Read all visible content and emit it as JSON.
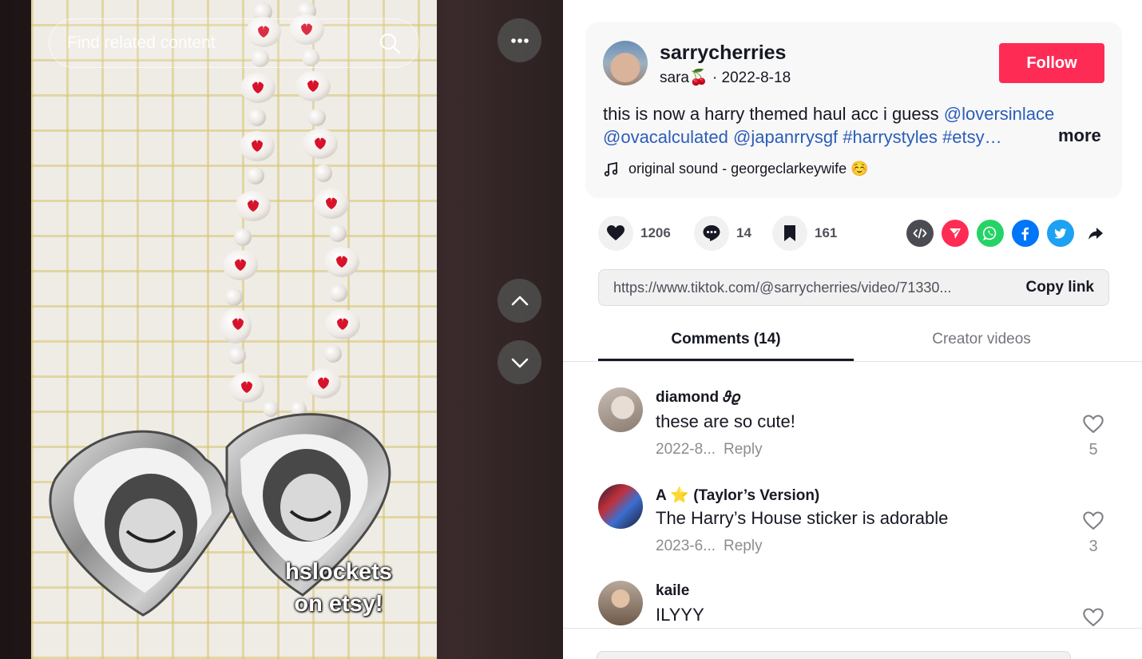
{
  "search": {
    "placeholder": "Find related content",
    "icon": "search-icon"
  },
  "video": {
    "overlay_line1": "hslockets",
    "overlay_line2": "on etsy!",
    "more_icon": "more-horizontal-icon",
    "prev_icon": "chevron-up-icon",
    "next_icon": "chevron-down-icon"
  },
  "author": {
    "username": "sarrycherries",
    "nickname": "sara🍒",
    "separator": " · ",
    "date": "2022-8-18",
    "follow_label": "Follow"
  },
  "caption": {
    "text": "this is now a harry themed haul acc i guess ",
    "tag1": "@loversinlace",
    "tag2": "@ovacalculated",
    "tag3": "@japanrrysgf",
    "tag4": "#harrystyles",
    "tag5": "#etsy…",
    "more_label": "more"
  },
  "sound": {
    "label": "original sound - georgeclarkeywife ☺️",
    "icon": "music-note-icon"
  },
  "stats": {
    "likes": "1206",
    "comments": "14",
    "saves": "161"
  },
  "share_icons": [
    "embed-icon",
    "send-icon",
    "whatsapp-icon",
    "facebook-icon",
    "twitter-icon",
    "share-arrow-icon"
  ],
  "colors": {
    "accent": "#fe2c55",
    "link": "#2b5db9",
    "whatsapp": "#25d366",
    "facebook": "#0075fa",
    "twitter": "#1da1f2",
    "embed": "#4b4c53"
  },
  "copy": {
    "url": "https://www.tiktok.com/@sarrycherries/video/71330...",
    "button_label": "Copy link"
  },
  "tabs": {
    "comments": "Comments (14)",
    "creator_videos": "Creator videos"
  },
  "comments": [
    {
      "name": "diamond 𝜗𝜚",
      "text": "these are so cute!",
      "date": "2022-8...",
      "reply": "Reply",
      "likes": "5"
    },
    {
      "name": "A ⭐ (Taylor’s Version)",
      "text": "The Harry’s House sticker is adorable",
      "date": "2023-6...",
      "reply": "Reply",
      "likes": "3"
    },
    {
      "name": "kaile",
      "text": "ILYYY",
      "date": "",
      "reply": "",
      "likes": ""
    }
  ]
}
